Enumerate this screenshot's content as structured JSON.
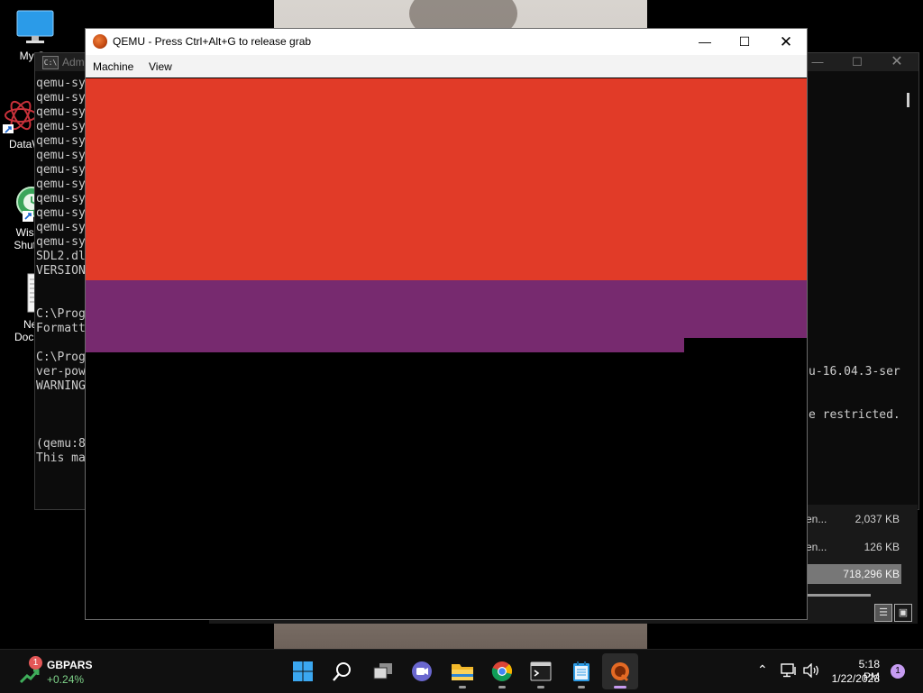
{
  "desktop": {
    "icons": [
      {
        "label_line1": "My Co",
        "label_line2": ""
      },
      {
        "label_line1": "DataW",
        "label_line2": ""
      },
      {
        "label_line1": "Wise",
        "label_line2": "Shutd"
      },
      {
        "label_line1": "New",
        "label_line2": "Docum"
      }
    ]
  },
  "console": {
    "title": "Adm",
    "lines": [
      "qemu-sy",
      "qemu-sy",
      "qemu-sy",
      "qemu-sy",
      "qemu-sy",
      "qemu-sy",
      "qemu-sy",
      "qemu-sy",
      "qemu-sy",
      "qemu-sy",
      "qemu-sy",
      "qemu-sy",
      "SDL2.dl",
      "VERSION",
      "",
      "",
      "C:\\Prog",
      "Formatt",
      "",
      "C:\\Prog",
      "ver-pow",
      "WARNING",
      "",
      "",
      "",
      "(qemu:8",
      "This ma"
    ],
    "right_lines": [
      "u-16.04.3-ser",
      "",
      "",
      "e restricted."
    ]
  },
  "explorer": {
    "rows": [
      {
        "name": "en...",
        "size": "2,037 KB"
      },
      {
        "name": "en...",
        "size": "126 KB"
      },
      {
        "name": "",
        "size": "718,296 KB"
      }
    ]
  },
  "qemu": {
    "title": "QEMU - Press Ctrl+Alt+G to release grab",
    "menu": [
      "Machine",
      "View"
    ],
    "colors": {
      "red": "#e13b28",
      "purple": "#772a6f",
      "black": "#000000"
    }
  },
  "taskbar": {
    "widget": {
      "badge": "1",
      "name": "GBPARS",
      "change": "+0.24%"
    },
    "apps": [
      "start-icon",
      "search-icon",
      "task-view-icon",
      "teams-chat-icon",
      "file-explorer-icon",
      "chrome-icon",
      "terminal-icon",
      "notepad-icon",
      "qemu-icon"
    ],
    "clock": {
      "time": "5:18 PM",
      "date": "1/22/2023"
    },
    "notification_count": "1"
  }
}
